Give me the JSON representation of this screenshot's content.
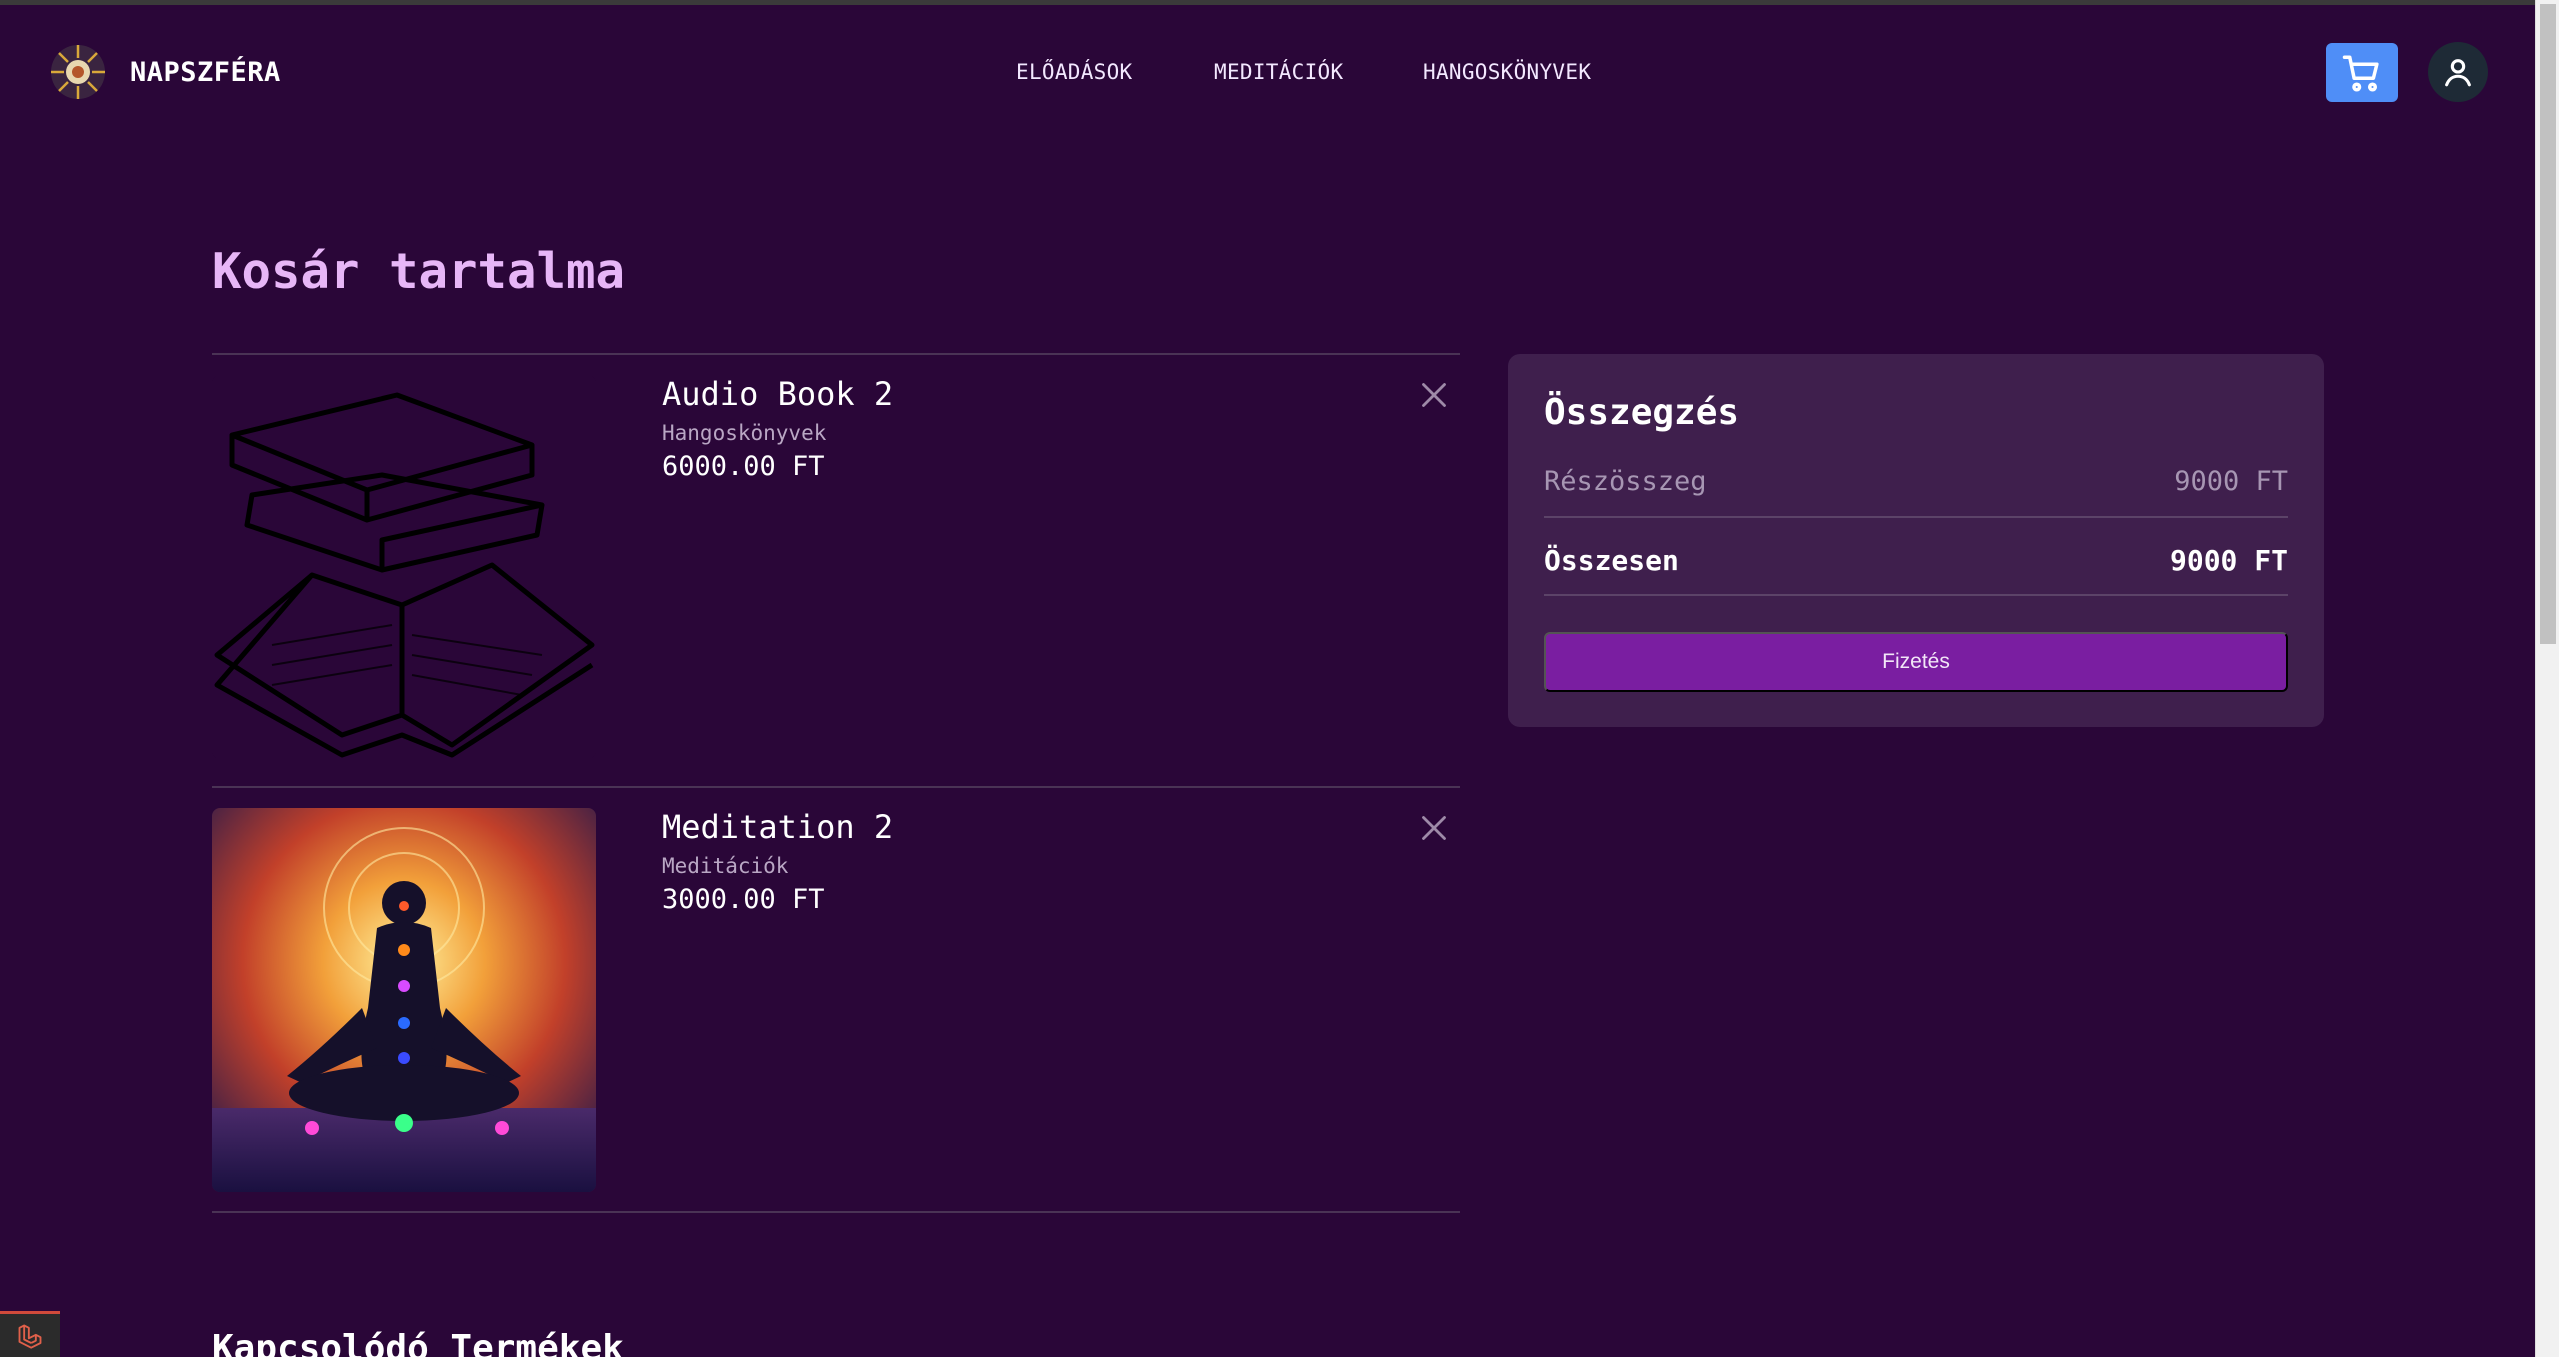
{
  "header": {
    "brand": "NAPSZFÉRA",
    "nav": [
      "ELŐADÁSOK",
      "MEDITÁCIÓK",
      "HANGOSKÖNYVEK"
    ]
  },
  "page": {
    "title": "Kosár tartalma"
  },
  "cart": {
    "items": [
      {
        "name": "Audio Book 2",
        "category": "Hangoskönyvek",
        "price": "6000.00 FT"
      },
      {
        "name": "Meditation 2",
        "category": "Meditációk",
        "price": "3000.00 FT"
      }
    ]
  },
  "summary": {
    "title": "Összegzés",
    "subtotal_label": "Részösszeg",
    "subtotal_value": "9000 FT",
    "total_label": "Összesen",
    "total_value": "9000 FT",
    "pay_label": "Fizetés"
  },
  "related": {
    "title": "Kapcsolódó Termékek"
  },
  "colors": {
    "background": "#2a0638",
    "accent": "#7a1ea1",
    "cart_button": "#4f8ef7",
    "title": "#e7b6f7"
  }
}
